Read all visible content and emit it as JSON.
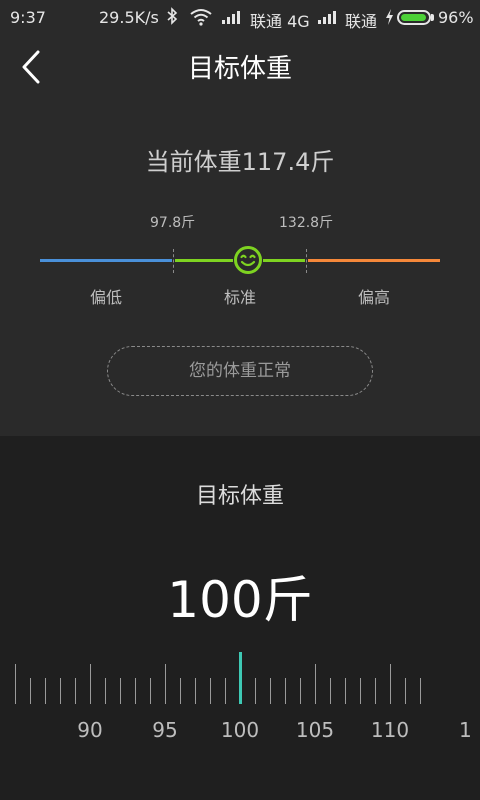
{
  "status_bar": {
    "time": "9:37",
    "speed": "29.5K/s",
    "carrier1": "联通 4G",
    "carrier2": "联通",
    "battery": "96%",
    "battery_level": 0.96,
    "battery_color": "#4cd137"
  },
  "header": {
    "title": "目标体重",
    "back_icon": "chevron-left-icon"
  },
  "current": {
    "label": "当前体重117.4斤"
  },
  "range": {
    "low_threshold": "97.8斤",
    "high_threshold": "132.8斤",
    "low_label": "偏低",
    "normal_label": "标准",
    "high_label": "偏高",
    "colors": {
      "low": "#4a90d9",
      "normal": "#7ed321",
      "high": "#f5883a"
    },
    "indicator_icon": "smile-icon"
  },
  "status_message": "您的体重正常",
  "target": {
    "title": "目标体重",
    "value": "100斤",
    "ruler_min": 85,
    "ruler_max": 112,
    "selected": 100,
    "accent": "#3ec9b4",
    "tick_labels": [
      "90",
      "95",
      "100",
      "105",
      "110",
      "1"
    ]
  }
}
